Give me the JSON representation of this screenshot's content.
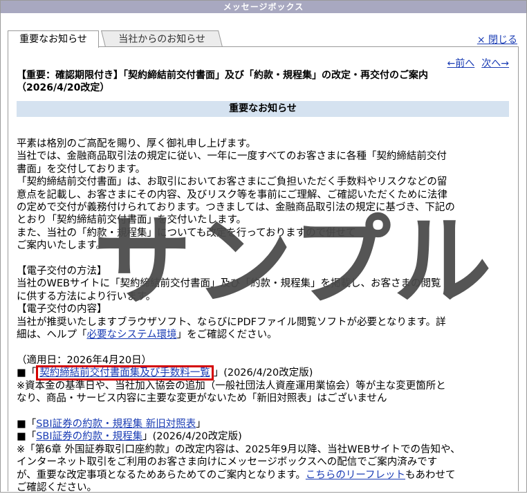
{
  "window": {
    "title": "メッセージボックス"
  },
  "tabs": [
    {
      "label": "重要なお知らせ",
      "active": true
    },
    {
      "label": "当社からのお知らせ",
      "active": false
    }
  ],
  "close_label": "× 閉じる",
  "nav": {
    "prev": "←前へ",
    "next": "次へ→"
  },
  "article": {
    "title_line1": "【重要：確認期限付き】「契約締結前交付書面」及び「約款・規程集」の改定・再交付のご案内",
    "title_line2": "（2026/4/20改定）",
    "band_label": "重要なお知らせ",
    "lines": {
      "l1": "平素は格別のご高配を賜り、厚く御礼申し上げます。",
      "l2": "当社では、金融商品取引法の規定に従い、一年に一度すべてのお客さまに各種「契約締結前交付",
      "l3": "書面」を交付しております。",
      "l4": "「契約締結前交付書面」は、お取引においてお客さまにご負担いただく手数料やリスクなどの留",
      "l5": "意点を記載し、お客さまにその内容、及びリスク等を事前にご理解、ご確認いただくために法律",
      "l6": "の定めで交付が義務付けられております。つきましては、金融商品取引法の規定に基づき、下記の",
      "l7": "とおり「契約締結前交付書面」を交付いたします。",
      "l8": "また、当社の「約款・規程集」についても改定を行っておりますので併せて",
      "l9": "ご案内いたします。",
      "h1": "【電子交付の方法】",
      "l10": "当社のWEBサイトに「契約締結前交付書面」及び「約款・規程集」を掲載し、お客さまの閲覧",
      "l11": "に供する方法により行います。",
      "h2": "【電子交付の内容】",
      "l12": "当社が推奨いたしますブラウザソフト、ならびにPDFファイル閲覧ソフトが必要となります。詳",
      "l13_pre": "細は、ヘルプ「",
      "l13_link": "必要なシステム環境",
      "l13_post": "」をご確認ください。",
      "date_line": "（適用日：2026年4月20日）",
      "item1_pre": "■「",
      "item1_link": "契約締結前交付書面集及び手数料一覧",
      "item1_post": "」(2026/4/20改定版)",
      "note1a": "※資本金の基準日や、当社加入協会の追加（一般社団法人資産運用業協会）等が主な変更箇所と",
      "note1b": "なり、商品・サービス内容に主要な変更がないため「新旧対照表」はございません",
      "item2_pre": "■「",
      "item2_link": "SBI証券の約款・規程集 新旧対照表",
      "item2_post": "」",
      "item3_pre": "■「",
      "item3_link": "SBI証券の約款・規程集",
      "item3_post": "」(2026/4/20改定版)",
      "note2a": "※「第6章 外国証券取引口座約款」の改定内容は、2025年9月以降、当社WEBサイトでの告知や、",
      "note2b": "インターネット取引をご利用のお客さま向けにメッセージボックスへの配信でご案内済みです",
      "note2c_pre": "が、重要な改定事項となるためあらためてのご案内となります。",
      "note2c_link": "こちらのリーフレット",
      "note2c_post": "もあわせて",
      "note2d": "ご確認ください。"
    }
  },
  "watermark": "サンプル",
  "colors": {
    "titlebar": "#a8a8c0",
    "band": "#d5e2f0",
    "link": "#1a3cb4",
    "highlight_box": "#d40000"
  }
}
